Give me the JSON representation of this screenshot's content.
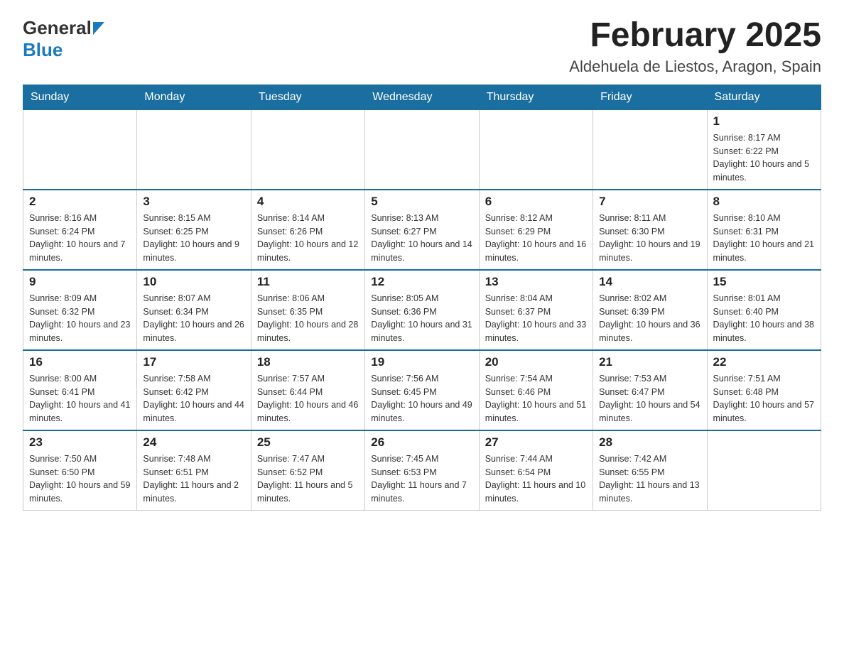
{
  "header": {
    "logo_general": "General",
    "logo_blue": "Blue",
    "title": "February 2025",
    "subtitle": "Aldehuela de Liestos, Aragon, Spain"
  },
  "days_of_week": [
    "Sunday",
    "Monday",
    "Tuesday",
    "Wednesday",
    "Thursday",
    "Friday",
    "Saturday"
  ],
  "weeks": [
    [
      {
        "day": "",
        "info": ""
      },
      {
        "day": "",
        "info": ""
      },
      {
        "day": "",
        "info": ""
      },
      {
        "day": "",
        "info": ""
      },
      {
        "day": "",
        "info": ""
      },
      {
        "day": "",
        "info": ""
      },
      {
        "day": "1",
        "info": "Sunrise: 8:17 AM\nSunset: 6:22 PM\nDaylight: 10 hours and 5 minutes."
      }
    ],
    [
      {
        "day": "2",
        "info": "Sunrise: 8:16 AM\nSunset: 6:24 PM\nDaylight: 10 hours and 7 minutes."
      },
      {
        "day": "3",
        "info": "Sunrise: 8:15 AM\nSunset: 6:25 PM\nDaylight: 10 hours and 9 minutes."
      },
      {
        "day": "4",
        "info": "Sunrise: 8:14 AM\nSunset: 6:26 PM\nDaylight: 10 hours and 12 minutes."
      },
      {
        "day": "5",
        "info": "Sunrise: 8:13 AM\nSunset: 6:27 PM\nDaylight: 10 hours and 14 minutes."
      },
      {
        "day": "6",
        "info": "Sunrise: 8:12 AM\nSunset: 6:29 PM\nDaylight: 10 hours and 16 minutes."
      },
      {
        "day": "7",
        "info": "Sunrise: 8:11 AM\nSunset: 6:30 PM\nDaylight: 10 hours and 19 minutes."
      },
      {
        "day": "8",
        "info": "Sunrise: 8:10 AM\nSunset: 6:31 PM\nDaylight: 10 hours and 21 minutes."
      }
    ],
    [
      {
        "day": "9",
        "info": "Sunrise: 8:09 AM\nSunset: 6:32 PM\nDaylight: 10 hours and 23 minutes."
      },
      {
        "day": "10",
        "info": "Sunrise: 8:07 AM\nSunset: 6:34 PM\nDaylight: 10 hours and 26 minutes."
      },
      {
        "day": "11",
        "info": "Sunrise: 8:06 AM\nSunset: 6:35 PM\nDaylight: 10 hours and 28 minutes."
      },
      {
        "day": "12",
        "info": "Sunrise: 8:05 AM\nSunset: 6:36 PM\nDaylight: 10 hours and 31 minutes."
      },
      {
        "day": "13",
        "info": "Sunrise: 8:04 AM\nSunset: 6:37 PM\nDaylight: 10 hours and 33 minutes."
      },
      {
        "day": "14",
        "info": "Sunrise: 8:02 AM\nSunset: 6:39 PM\nDaylight: 10 hours and 36 minutes."
      },
      {
        "day": "15",
        "info": "Sunrise: 8:01 AM\nSunset: 6:40 PM\nDaylight: 10 hours and 38 minutes."
      }
    ],
    [
      {
        "day": "16",
        "info": "Sunrise: 8:00 AM\nSunset: 6:41 PM\nDaylight: 10 hours and 41 minutes."
      },
      {
        "day": "17",
        "info": "Sunrise: 7:58 AM\nSunset: 6:42 PM\nDaylight: 10 hours and 44 minutes."
      },
      {
        "day": "18",
        "info": "Sunrise: 7:57 AM\nSunset: 6:44 PM\nDaylight: 10 hours and 46 minutes."
      },
      {
        "day": "19",
        "info": "Sunrise: 7:56 AM\nSunset: 6:45 PM\nDaylight: 10 hours and 49 minutes."
      },
      {
        "day": "20",
        "info": "Sunrise: 7:54 AM\nSunset: 6:46 PM\nDaylight: 10 hours and 51 minutes."
      },
      {
        "day": "21",
        "info": "Sunrise: 7:53 AM\nSunset: 6:47 PM\nDaylight: 10 hours and 54 minutes."
      },
      {
        "day": "22",
        "info": "Sunrise: 7:51 AM\nSunset: 6:48 PM\nDaylight: 10 hours and 57 minutes."
      }
    ],
    [
      {
        "day": "23",
        "info": "Sunrise: 7:50 AM\nSunset: 6:50 PM\nDaylight: 10 hours and 59 minutes."
      },
      {
        "day": "24",
        "info": "Sunrise: 7:48 AM\nSunset: 6:51 PM\nDaylight: 11 hours and 2 minutes."
      },
      {
        "day": "25",
        "info": "Sunrise: 7:47 AM\nSunset: 6:52 PM\nDaylight: 11 hours and 5 minutes."
      },
      {
        "day": "26",
        "info": "Sunrise: 7:45 AM\nSunset: 6:53 PM\nDaylight: 11 hours and 7 minutes."
      },
      {
        "day": "27",
        "info": "Sunrise: 7:44 AM\nSunset: 6:54 PM\nDaylight: 11 hours and 10 minutes."
      },
      {
        "day": "28",
        "info": "Sunrise: 7:42 AM\nSunset: 6:55 PM\nDaylight: 11 hours and 13 minutes."
      },
      {
        "day": "",
        "info": ""
      }
    ]
  ]
}
